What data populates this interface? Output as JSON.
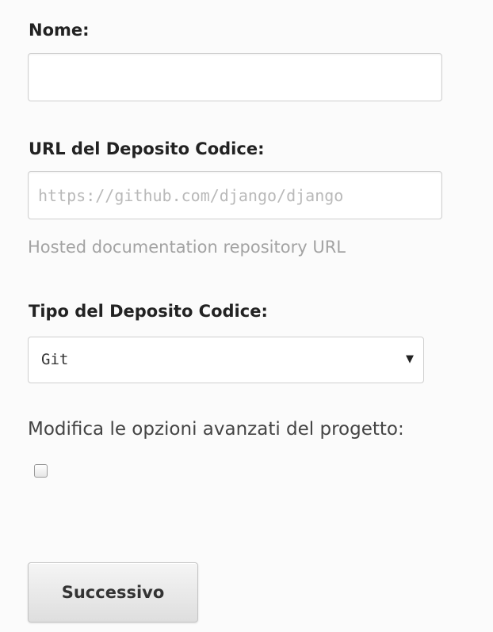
{
  "form": {
    "name_label": "Nome:",
    "name_value": "",
    "repo_url_label": "URL del Deposito Codice:",
    "repo_url_placeholder": "https://github.com/django/django",
    "repo_url_help": "Hosted documentation repository URL",
    "repo_type_label": "Tipo del Deposito Codice:",
    "repo_type_selected": "Git",
    "advanced_label": "Modifica le opzioni avanzati del progetto:",
    "advanced_checked": false,
    "next_button": "Successivo"
  },
  "icons": {
    "select_arrow": "triangle-down-icon"
  }
}
